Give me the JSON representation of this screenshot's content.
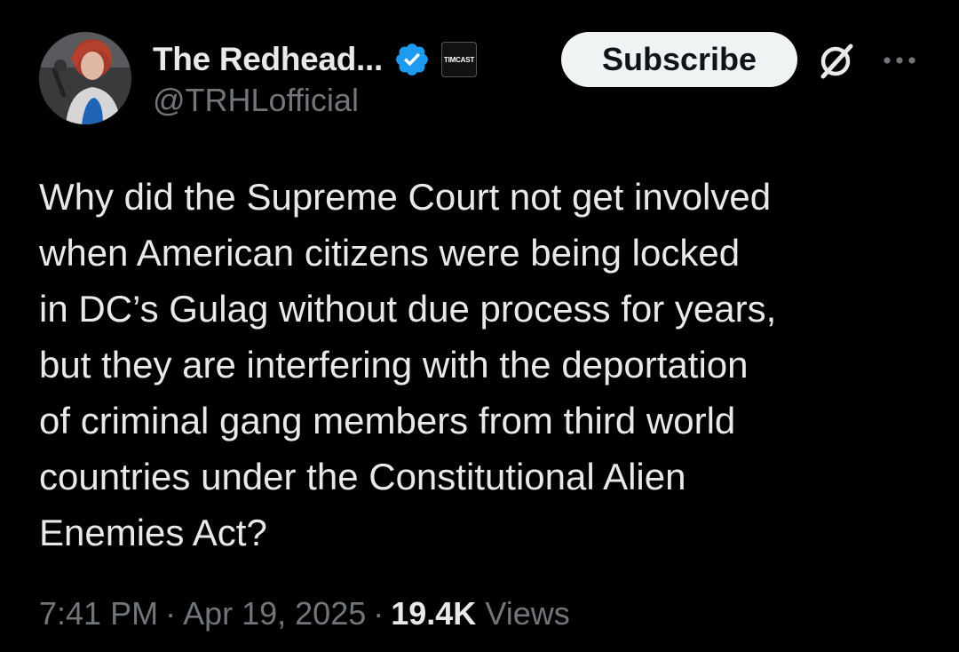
{
  "post": {
    "author": {
      "display_name": "The Redhead...",
      "handle": "@TRHLofficial",
      "verified": true,
      "affiliate_badge_text": "TIMCAST",
      "avatar_icon": "profile-photo"
    },
    "actions": {
      "subscribe_label": "Subscribe",
      "grok_icon": "grok-icon",
      "more_icon": "more-icon"
    },
    "text_lines": [
      "Why did the Supreme Court not get involved",
      "when American citizens were being locked",
      "in DC’s Gulag without due process for years,",
      "but they are interfering with the deportation",
      "of criminal gang members from third world",
      "countries under the Constitutional Alien",
      "Enemies Act?"
    ],
    "meta": {
      "time": "7:41 PM",
      "separator": "·",
      "date": "Apr 19, 2025",
      "views_count": "19.4K",
      "views_label": "Views"
    }
  },
  "colors": {
    "background": "#000000",
    "text_primary": "#e7e9ea",
    "text_secondary": "#71767b",
    "verified_blue": "#1d9bf0",
    "subscribe_bg": "#eff3f4"
  }
}
